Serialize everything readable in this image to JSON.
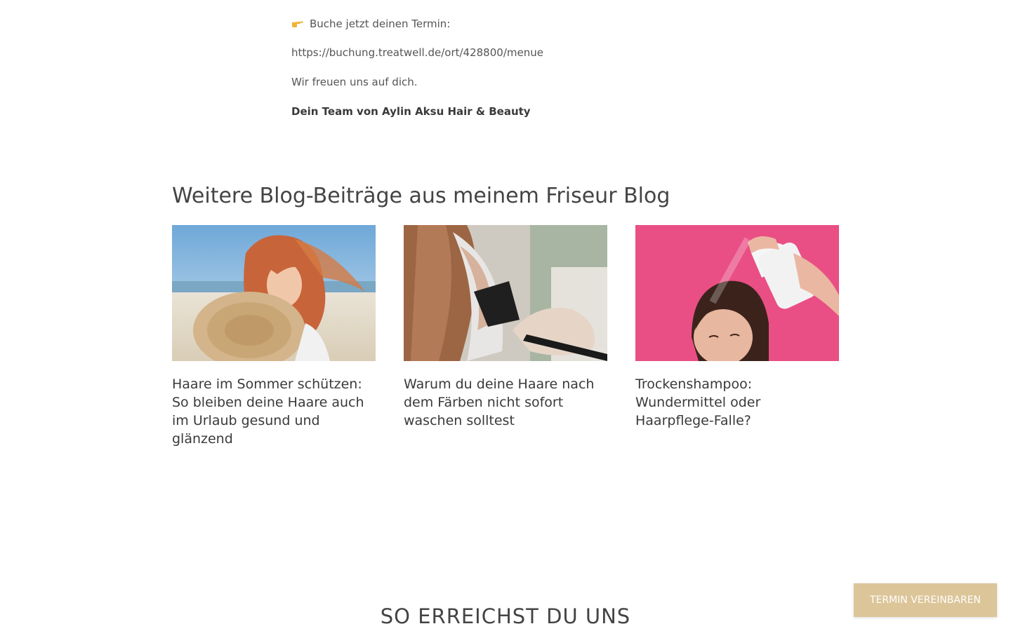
{
  "intro": {
    "booking_prompt": "Buche jetzt deinen Termin:",
    "booking_url": "https://buchung.treatwell.de/ort/428800/menue",
    "closing": "Wir freuen uns auf dich.",
    "signature": "Dein Team von Aylin Aksu Hair & Beauty"
  },
  "blog": {
    "heading": "Weitere Blog-Beiträge aus meinem Friseur Blog",
    "posts": [
      {
        "title": "Haare im Sommer schützen: So bleiben deine Haare auch im Urlaub gesund und glänzend"
      },
      {
        "title": "Warum du deine Haare nach dem Färben nicht sofort waschen solltest"
      },
      {
        "title": "Trockenshampoo: Wundermittel oder Haarpflege-Falle?"
      }
    ]
  },
  "footer": {
    "heading": "SO ERREICHST DU UNS"
  },
  "cta": {
    "label": "TERMIN VEREINBAREN"
  },
  "colors": {
    "accent": "#dcc598",
    "text": "#3a3a3a",
    "pink_bg": "#e94f84"
  },
  "icons": {
    "pointing": "pointing-hand-icon"
  }
}
